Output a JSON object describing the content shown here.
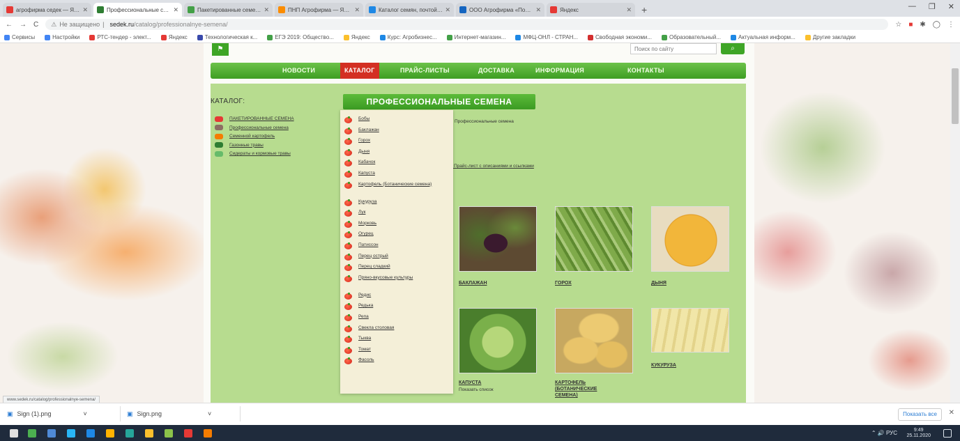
{
  "browser": {
    "tabs": [
      {
        "title": "агрофирма седек — Яндекс: на...",
        "color": "#e53935",
        "active": false
      },
      {
        "title": "Профессиональные семена от...",
        "color": "#2e7d32",
        "active": true
      },
      {
        "title": "Пакетированные семена...",
        "color": "#43a047",
        "active": false
      },
      {
        "title": "ПНП Агрофирма — Яндекс: По...",
        "color": "#fb8c00",
        "active": false
      },
      {
        "title": "Каталог семян, почтой в интерне...",
        "color": "#1e88e5",
        "active": false
      },
      {
        "title": "ООО Агрофирма «Поиск Моск...",
        "color": "#1565c0",
        "active": false
      },
      {
        "title": "Яндекс",
        "color": "#e53935",
        "active": false
      }
    ],
    "new_tab_symbol": "+",
    "window_controls": [
      "—",
      "❐",
      "✕"
    ],
    "nav_buttons": [
      "←",
      "→",
      "C"
    ],
    "security_label": "Не защищено",
    "url_host": "sedek.ru",
    "url_path": "/catalog/professionalnye-semena/",
    "bookmarks": [
      {
        "label": "Сервисы",
        "color": "#4285f4"
      },
      {
        "label": "Настройки",
        "color": "#4285f4"
      },
      {
        "label": "РТС-тендер - элект...",
        "color": "#e53935"
      },
      {
        "label": "Яндекс",
        "color": "#e53935"
      },
      {
        "label": "Технологическая к...",
        "color": "#3949ab"
      },
      {
        "label": "ЕГЭ 2019: Общество...",
        "color": "#43a047"
      },
      {
        "label": "Яндекс",
        "color": "#fbc02d"
      },
      {
        "label": "Курс: Агробизнес...",
        "color": "#1e88e5"
      },
      {
        "label": "Интернет-магазин...",
        "color": "#43a047"
      },
      {
        "label": "МФЦ-ОНЛ - СТРАН...",
        "color": "#1e88e5"
      },
      {
        "label": "Свободная экономи...",
        "color": "#d32f2f"
      },
      {
        "label": "Образовательный...",
        "color": "#43a047"
      },
      {
        "label": "Актуальная информ...",
        "color": "#1e88e5"
      },
      {
        "label": "Другие закладки",
        "color": "#fbc02d"
      }
    ],
    "status_url": "www.sedek.ru/catalog/professionalnye-semena/"
  },
  "site": {
    "logo_text": "⚑",
    "search_placeholder": "Поиск по сайту",
    "search_icon": "search-icon",
    "search_symbol": "⌕",
    "nav": [
      {
        "label": "НОВОСТИ",
        "active": false
      },
      {
        "label": "КАТАЛОГ",
        "active": true
      },
      {
        "label": "ПРАЙС-ЛИСТЫ",
        "active": false
      },
      {
        "label": "ДОСТАВКА",
        "active": false
      },
      {
        "label": "ИНФОРМАЦИЯ",
        "active": false
      },
      {
        "label": "КОНТАКТЫ",
        "active": false
      }
    ],
    "sidebar": {
      "title": "КАТАЛОГ:",
      "items": [
        {
          "label": "ПАКЕТИРОВАННЫЕ СЕМЕНА",
          "color": "#e53935"
        },
        {
          "label": "Профессиональные семена",
          "color": "#8d6e63"
        },
        {
          "label": "Семенной картофель",
          "color": "#f57c00"
        },
        {
          "label": "Газонные травы",
          "color": "#2e7d32"
        },
        {
          "label": "Сидераты и кормовые травы",
          "color": "#66bb6a"
        }
      ]
    },
    "section_title": "ПРОФЕССИОНАЛЬНЫЕ СЕМЕНА",
    "breadcrumb": "Профессиональные семена",
    "catalog_link": "на Прайс-лист с описаниями и ссылками",
    "products": [
      {
        "label": "БАКЛАЖАН",
        "sub": ""
      },
      {
        "label": "ГОРОХ",
        "sub": ""
      },
      {
        "label": "ДЫНЯ",
        "sub": ""
      },
      {
        "label": "КАПУСТА",
        "sub": "Показать список"
      },
      {
        "label": "КАРТОФЕЛЬ (БОТАНИЧЕСКИЕ СЕМЕНА)",
        "sub": ""
      },
      {
        "label": "КУКУРУЗА",
        "sub": ""
      }
    ],
    "dropdown": [
      {
        "label": "Бобы",
        "two": false
      },
      {
        "label": "Баклажан",
        "two": false
      },
      {
        "label": "Горох",
        "two": false
      },
      {
        "label": "Дыня",
        "two": false
      },
      {
        "label": "Кабачок",
        "two": false
      },
      {
        "label": "Капуста",
        "two": false
      },
      {
        "label": "Картофель (Ботанические семена)",
        "two": true
      },
      {
        "label": "Кукуруза",
        "two": false
      },
      {
        "label": "Лук",
        "two": false
      },
      {
        "label": "Морковь",
        "two": false
      },
      {
        "label": "Огурец",
        "two": false
      },
      {
        "label": "Патиссон",
        "two": false
      },
      {
        "label": "Перец острый",
        "two": false
      },
      {
        "label": "Перец сладкий",
        "two": false
      },
      {
        "label": "Пряно-вкусовые культуры",
        "two": true
      },
      {
        "label": "Редис",
        "two": false
      },
      {
        "label": "Редька",
        "two": false
      },
      {
        "label": "Репа",
        "two": false
      },
      {
        "label": "Свекла столовая",
        "two": false
      },
      {
        "label": "Тыква",
        "two": false
      },
      {
        "label": "Томат",
        "two": false
      },
      {
        "label": "Фасоль",
        "two": false
      }
    ]
  },
  "downloads": [
    {
      "name": "Sign (1).png",
      "icon": "▣",
      "caret": "˅"
    },
    {
      "name": "Sign.png",
      "icon": "▣",
      "caret": "˅"
    }
  ],
  "download_show_all": "Показать все",
  "download_close": "✕",
  "taskbar": {
    "time": "9:49",
    "date": "25.11.2020",
    "tray": "⌃ 🔊 РУС",
    "icon_colors": [
      "#e0e0e0",
      "#4caf50",
      "#4f8ad6",
      "#29b6f6",
      "#1e88e5",
      "#ffb300",
      "#26a69a",
      "#fbc02d",
      "#8bc34a",
      "#e53935",
      "#f57c00"
    ]
  }
}
